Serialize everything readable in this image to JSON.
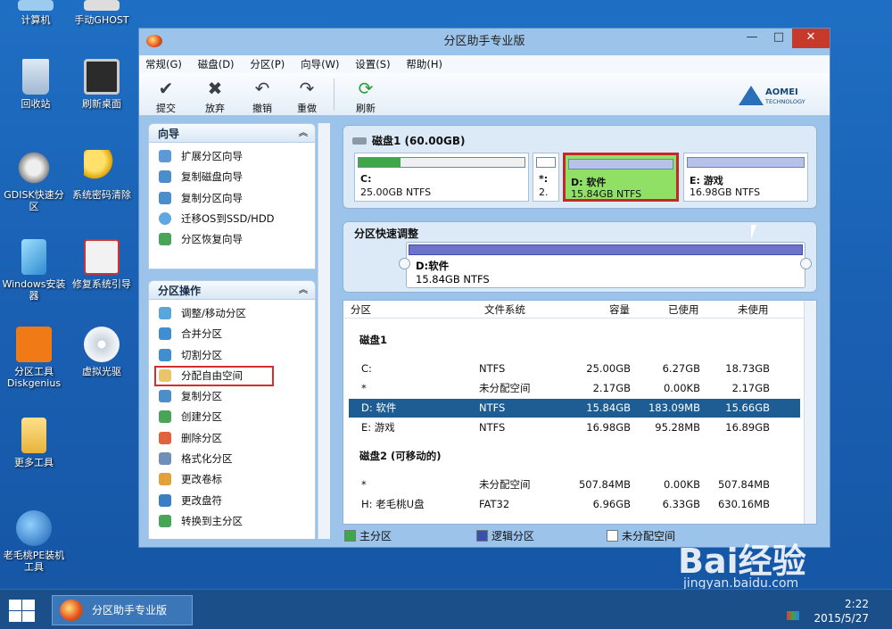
{
  "desktop": {
    "icons": [
      {
        "label": "计算机"
      },
      {
        "label": "手动GHOST"
      },
      {
        "label": "回收站"
      },
      {
        "label": "刷新桌面"
      },
      {
        "label": "GDISK快速分区"
      },
      {
        "label": "系统密码清除"
      },
      {
        "label": "Windows安装器"
      },
      {
        "label": "修复系统引导"
      },
      {
        "label": "分区工具Diskgenius"
      },
      {
        "label": "虚拟光驱"
      },
      {
        "label": "更多工具"
      },
      {
        "label": "老毛桃PE装机工具"
      }
    ]
  },
  "window": {
    "title": "分区助手专业版",
    "controls": {
      "minimize": "—",
      "maximize": "□",
      "close": "✕"
    },
    "menu": [
      "常规(G)",
      "磁盘(D)",
      "分区(P)",
      "向导(W)",
      "设置(S)",
      "帮助(H)"
    ],
    "toolbar": [
      {
        "label": "提交",
        "icon": "check-icon"
      },
      {
        "label": "放弃",
        "icon": "x-icon"
      },
      {
        "label": "撤销",
        "icon": "undo-icon"
      },
      {
        "label": "重做",
        "icon": "redo-icon"
      },
      {
        "label": "刷新",
        "icon": "refresh-icon"
      }
    ],
    "brand": {
      "name": "AOMEI",
      "sub": "TECHNOLOGY"
    }
  },
  "wizard_panel": {
    "title": "向导",
    "chevron": "︽",
    "items": [
      "扩展分区向导",
      "复制磁盘向导",
      "复制分区向导",
      "迁移OS到SSD/HDD",
      "分区恢复向导"
    ]
  },
  "ops_panel": {
    "title": "分区操作",
    "chevron": "︽",
    "items": [
      "调整/移动分区",
      "合并分区",
      "切割分区",
      "分配自由空间",
      "复制分区",
      "创建分区",
      "删除分区",
      "格式化分区",
      "更改卷标",
      "更改盘符",
      "转换到主分区"
    ],
    "highlighted_index": 3
  },
  "disk_map": {
    "disk_label": "磁盘1 (60.00GB)",
    "partitions": [
      {
        "name": "C:",
        "size": "25.00GB NTFS",
        "used_fraction": 0.25,
        "color": "#3da84a"
      },
      {
        "name": "*:",
        "size": "2.",
        "used_fraction": 0,
        "color": "#ffffff"
      },
      {
        "name": "D: 软件",
        "size": "15.84GB NTFS",
        "used_fraction": 0.01,
        "color": "#8fa0d8",
        "selected": true
      },
      {
        "name": "E: 游戏",
        "size": "16.98GB NTFS",
        "used_fraction": 0.01,
        "color": "#8fa0d8"
      }
    ]
  },
  "quick_adjust": {
    "title": "分区快速调整",
    "partition_name": "D:软件",
    "partition_size": "15.84GB NTFS"
  },
  "table": {
    "headers": [
      "分区",
      "文件系统",
      "容量",
      "已使用",
      "未使用"
    ],
    "groups": [
      {
        "name": "磁盘1",
        "rows": [
          {
            "partition": "C:",
            "fs": "NTFS",
            "capacity": "25.00GB",
            "used": "6.27GB",
            "free": "18.73GB"
          },
          {
            "partition": "*",
            "fs": "未分配空间",
            "capacity": "2.17GB",
            "used": "0.00KB",
            "free": "2.17GB"
          },
          {
            "partition": "D: 软件",
            "fs": "NTFS",
            "capacity": "15.84GB",
            "used": "183.09MB",
            "free": "15.66GB",
            "selected": true
          },
          {
            "partition": "E: 游戏",
            "fs": "NTFS",
            "capacity": "16.98GB",
            "used": "95.28MB",
            "free": "16.89GB"
          }
        ]
      },
      {
        "name": "磁盘2 (可移动的)",
        "rows": [
          {
            "partition": "*",
            "fs": "未分配空间",
            "capacity": "507.84MB",
            "used": "0.00KB",
            "free": "507.84MB"
          },
          {
            "partition": "H: 老毛桃U盘",
            "fs": "FAT32",
            "capacity": "6.96GB",
            "used": "6.33GB",
            "free": "630.16MB"
          }
        ]
      }
    ]
  },
  "legend": [
    {
      "label": "主分区",
      "color": "#3da84a"
    },
    {
      "label": "逻辑分区",
      "color": "#3b4fb0"
    },
    {
      "label": "未分配空间",
      "color": "#ffffff"
    }
  ],
  "taskbar": {
    "app_label": "分区助手专业版",
    "time": "2:22",
    "date": "2015/5/27"
  },
  "watermark": {
    "brand": "Bai经验",
    "url": "jingyan.baidu.com"
  }
}
